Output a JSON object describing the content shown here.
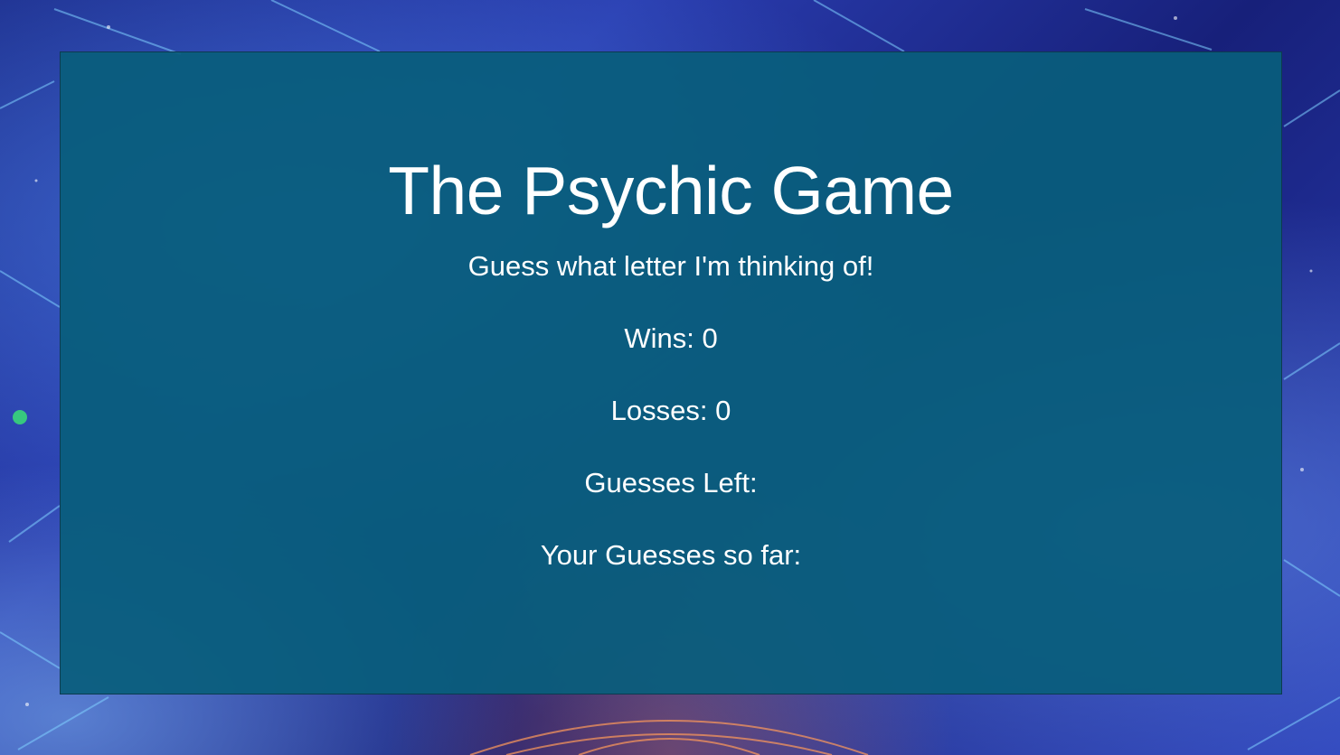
{
  "game": {
    "title": "The Psychic Game",
    "tagline": "Guess what letter I'm thinking of!",
    "wins_label": "Wins:",
    "wins_value": "0",
    "losses_label": "Losses:",
    "losses_value": "0",
    "guesses_left_label": "Guesses Left:",
    "guesses_left_value": "",
    "guesses_so_far_label": "Your Guesses so far:",
    "guesses_so_far_value": ""
  },
  "colors": {
    "panel": "#095e7c",
    "text": "#ffffff",
    "background": "#1b2a8a"
  }
}
